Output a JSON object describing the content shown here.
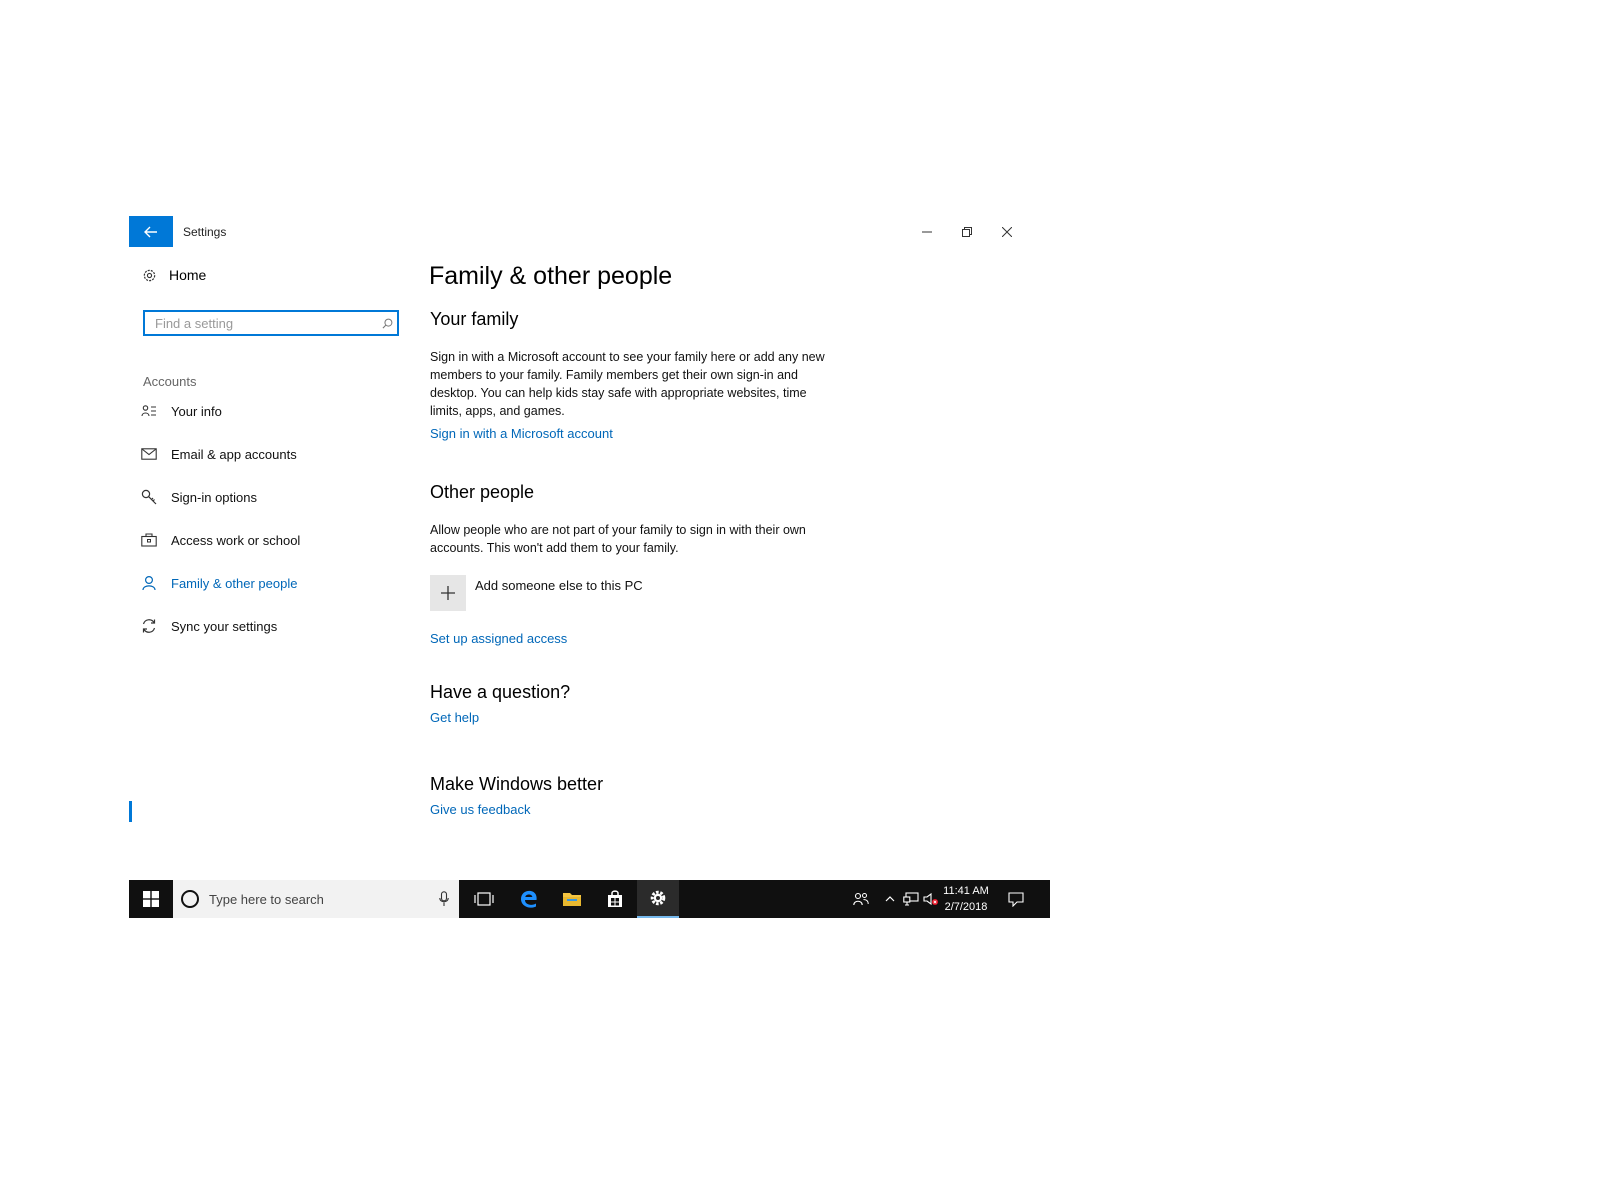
{
  "window": {
    "title": "Settings"
  },
  "sidebar": {
    "home_label": "Home",
    "search_placeholder": "Find a setting",
    "section_label": "Accounts",
    "items": [
      {
        "label": "Your info",
        "icon": "person-card-icon"
      },
      {
        "label": "Email & app accounts",
        "icon": "envelope-icon"
      },
      {
        "label": "Sign-in options",
        "icon": "key-icon"
      },
      {
        "label": "Access work or school",
        "icon": "briefcase-icon"
      },
      {
        "label": "Family & other people",
        "icon": "person-icon",
        "active": true
      },
      {
        "label": "Sync your settings",
        "icon": "sync-icon"
      }
    ]
  },
  "main": {
    "title": "Family & other people",
    "your_family": {
      "heading": "Your family",
      "description": "Sign in with a Microsoft account to see your family here or add any new members to your family. Family members get their own sign-in and desktop. You can help kids stay safe with appropriate websites, time limits, apps, and games.",
      "link": "Sign in with a Microsoft account"
    },
    "other_people": {
      "heading": "Other people",
      "description": "Allow people who are not part of your family to sign in with their own accounts. This won't add them to your family.",
      "add_label": "Add someone else to this PC",
      "link": "Set up assigned access"
    },
    "question": {
      "heading": "Have a question?",
      "link": "Get help"
    },
    "feedback": {
      "heading": "Make Windows better",
      "link": "Give us feedback"
    }
  },
  "taskbar": {
    "search_placeholder": "Type here to search",
    "time": "11:41 AM",
    "date": "2/7/2018"
  },
  "colors": {
    "accent": "#0078d7",
    "link": "#0067b8",
    "taskbar": "#101010"
  }
}
